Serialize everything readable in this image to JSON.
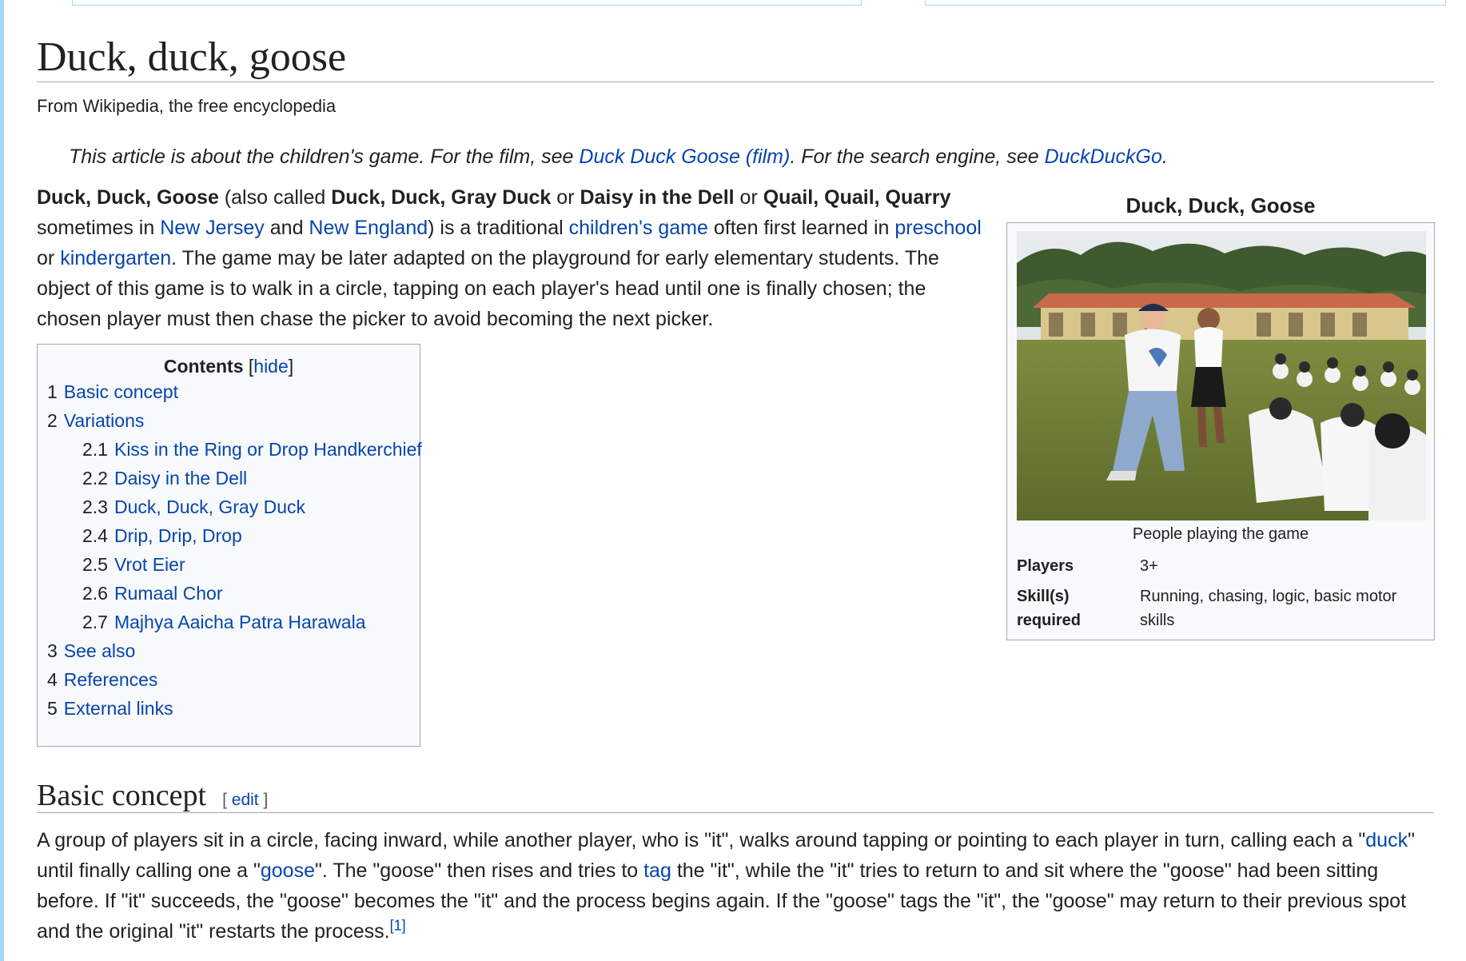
{
  "page": {
    "title": "Duck, duck, goose",
    "tagline": "From Wikipedia, the free encyclopedia"
  },
  "hatnote": {
    "prefix": "This article is about the children's game. For the film, see ",
    "film_link": "Duck Duck Goose (film)",
    "middle": ". For the search engine, see ",
    "engine_link": "DuckDuckGo",
    "suffix": "."
  },
  "lead": {
    "b1": "Duck, Duck, Goose",
    "t1": " (also called ",
    "b2": "Duck, Duck, Gray Duck",
    "t2": " or ",
    "b3": "Daisy in the Dell",
    "t3": " or ",
    "b4": "Quail, Quail, Quarry",
    "t4": " sometimes in ",
    "l1": "New Jersey",
    "t5": " and ",
    "l2": "New England",
    "t6": ") is a traditional ",
    "l3": "children's game",
    "t7": " often first learned in ",
    "l4": "preschool",
    "t8": " or ",
    "l5": "kindergarten",
    "t9": ". The game may be later adapted on the playground for early elementary students. The object of this game is to walk in a circle, tapping on each player's head until one is finally chosen; the chosen player must then chase the picker to avoid becoming the next picker."
  },
  "toc": {
    "title": "Contents",
    "hide_open": "[",
    "hide": "hide",
    "hide_close": "]",
    "items": [
      {
        "num": "1",
        "label": "Basic concept"
      },
      {
        "num": "2",
        "label": "Variations"
      },
      {
        "num": "2.1",
        "label": "Kiss in the Ring or Drop Handkerchief"
      },
      {
        "num": "2.2",
        "label": "Daisy in the Dell"
      },
      {
        "num": "2.3",
        "label": "Duck, Duck, Gray Duck"
      },
      {
        "num": "2.4",
        "label": "Drip, Drip, Drop"
      },
      {
        "num": "2.5",
        "label": "Vrot Eier"
      },
      {
        "num": "2.6",
        "label": "Rumaal Chor"
      },
      {
        "num": "2.7",
        "label": "Majhya Aaicha Patra Harawala"
      },
      {
        "num": "3",
        "label": "See also"
      },
      {
        "num": "4",
        "label": "References"
      },
      {
        "num": "5",
        "label": "External links"
      }
    ]
  },
  "infobox": {
    "caption": "Duck, Duck, Goose",
    "image_caption": "People playing the game",
    "players_label": "Players",
    "players_value": "3+",
    "skills_label": "Skill(s) required",
    "skills_value": "Running, chasing, logic, basic motor skills"
  },
  "section": {
    "heading": "Basic concept",
    "edit_open": "[ ",
    "edit": "edit",
    "edit_close": " ]",
    "p1": "A group of players sit in a circle, facing inward, while another player, who is \"it\", walks around tapping or pointing to each player in turn, calling each a \"",
    "l_duck": "duck",
    "p2": "\" until finally calling one a \"",
    "l_goose": "goose",
    "p3": "\". The \"goose\" then rises and tries to ",
    "l_tag": "tag",
    "p4": " the \"it\", while the \"it\" tries to return to and sit where the \"goose\" had been sitting before. If \"it\" succeeds, the \"goose\" becomes the \"it\" and the process begins again. If the \"goose\" tags the \"it\", the \"goose\" may return to their previous spot and the original \"it\" restarts the process.",
    "ref": "[1]"
  },
  "colors": {
    "link": "#0645ad",
    "text": "#202122",
    "border": "#a2a9b1",
    "panel": "#f8f9fa"
  }
}
